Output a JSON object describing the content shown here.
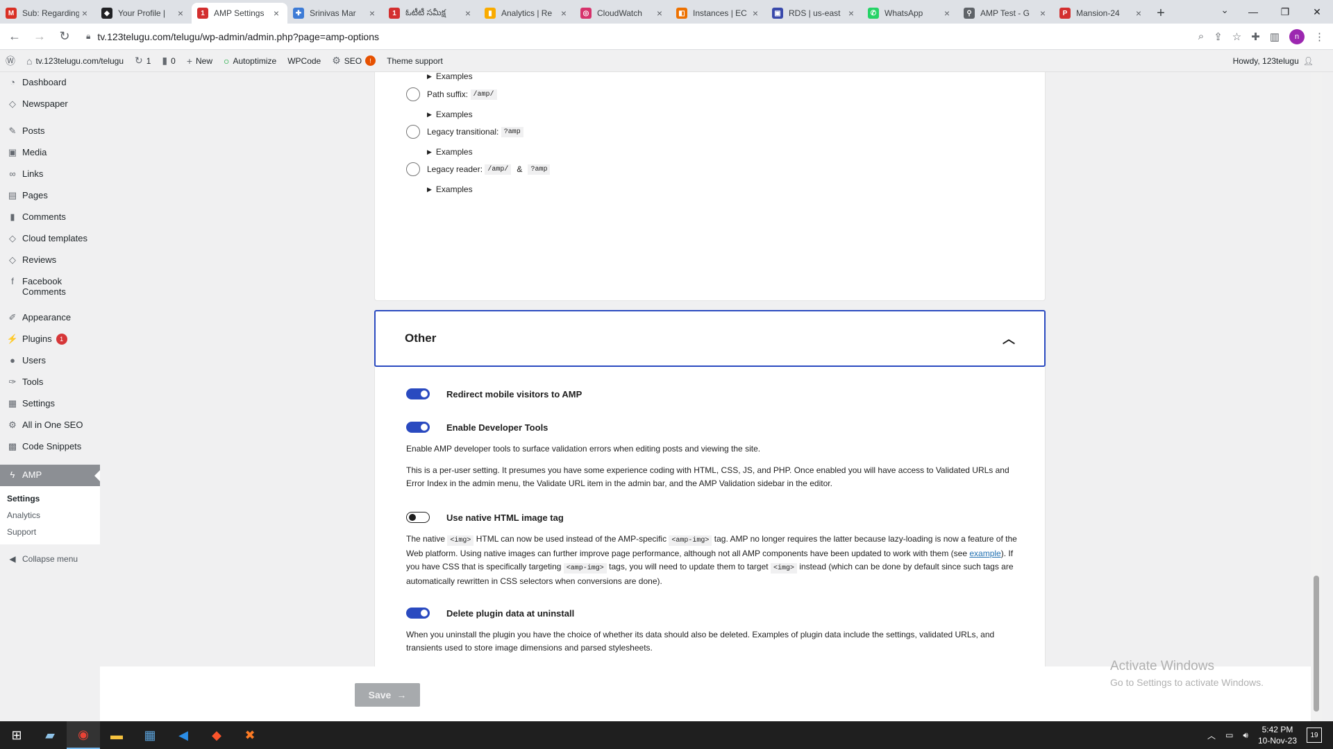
{
  "browser": {
    "tabs": [
      {
        "title": "Sub: Regarding",
        "favicon": "gmail-icon",
        "color": "#d93025",
        "glyph": "M"
      },
      {
        "title": "Your Profile |",
        "favicon": "eye-icon",
        "color": "#202124",
        "glyph": "◆"
      },
      {
        "title": "AMP Settings",
        "favicon": "123telugu-icon",
        "color": "#d32f2f",
        "glyph": "1",
        "active": true
      },
      {
        "title": "Srinivas Mar",
        "favicon": "puzzle-icon",
        "color": "#3d7bd6",
        "glyph": "✚"
      },
      {
        "title": "ఓటీటీ సమీక్ష",
        "favicon": "123telugu-icon",
        "color": "#d32f2f",
        "glyph": "1"
      },
      {
        "title": "Analytics | Re",
        "favicon": "analytics-icon",
        "color": "#f9ab00",
        "glyph": "▮"
      },
      {
        "title": "CloudWatch",
        "favicon": "cloudwatch-icon",
        "color": "#d6336c",
        "glyph": "◎"
      },
      {
        "title": "Instances | EC",
        "favicon": "ec2-icon",
        "color": "#ed7100",
        "glyph": "◧"
      },
      {
        "title": "RDS | us-east",
        "favicon": "rds-icon",
        "color": "#3949ab",
        "glyph": "▣"
      },
      {
        "title": "WhatsApp",
        "favicon": "whatsapp-icon",
        "color": "#25d366",
        "glyph": "✆"
      },
      {
        "title": "AMP Test - G",
        "favicon": "amp-test-icon",
        "color": "#5f6368",
        "glyph": "⚲"
      },
      {
        "title": "Mansion-24",
        "favicon": "mansion-icon",
        "color": "#d32f2f",
        "glyph": "P"
      }
    ],
    "url": "tv.123telugu.com/telugu/wp-admin/admin.php?page=amp-options"
  },
  "adminbar": {
    "site": "tv.123telugu.com/telugu",
    "updates": "1",
    "comments": "0",
    "new": "New",
    "autoptimize": "Autoptimize",
    "wpcode": "WPCode",
    "seo": "SEO",
    "seo_badge": "!",
    "theme_support": "Theme support",
    "howdy": "Howdy, 123telugu"
  },
  "sidebar": {
    "items": [
      {
        "label": "Dashboard",
        "icon": "dashboard-icon"
      },
      {
        "label": "Newspaper",
        "icon": "newspaper-icon"
      },
      {
        "label": "Posts",
        "icon": "pin-icon"
      },
      {
        "label": "Media",
        "icon": "media-icon"
      },
      {
        "label": "Links",
        "icon": "link-icon"
      },
      {
        "label": "Pages",
        "icon": "pages-icon"
      },
      {
        "label": "Comments",
        "icon": "comment-icon"
      },
      {
        "label": "Cloud templates",
        "icon": "cloud-icon"
      },
      {
        "label": "Reviews",
        "icon": "review-icon"
      },
      {
        "label": "Facebook Comments",
        "icon": "facebook-icon"
      },
      {
        "label": "Appearance",
        "icon": "brush-icon"
      },
      {
        "label": "Plugins",
        "icon": "plug-icon",
        "badge": "1"
      },
      {
        "label": "Users",
        "icon": "user-icon"
      },
      {
        "label": "Tools",
        "icon": "wrench-icon"
      },
      {
        "label": "Settings",
        "icon": "settings-icon"
      },
      {
        "label": "All in One SEO",
        "icon": "seo-icon"
      },
      {
        "label": "Code Snippets",
        "icon": "code-icon"
      },
      {
        "label": "AMP",
        "icon": "amp-icon"
      }
    ],
    "submenu": [
      "Settings",
      "Analytics",
      "Support"
    ],
    "collapse": "Collapse menu"
  },
  "url_structure": {
    "path_suffix_label": "Path suffix:",
    "path_suffix_code": "/amp/",
    "legacy_transitional_label": "Legacy transitional:",
    "legacy_transitional_code": "?amp",
    "legacy_reader_label": "Legacy reader:",
    "legacy_reader_code1": "/amp/",
    "legacy_reader_amp": "&",
    "legacy_reader_code2": "?amp",
    "examples": "Examples"
  },
  "other": {
    "title": "Other",
    "redirect_label": "Redirect mobile visitors to AMP",
    "devtools_label": "Enable Developer Tools",
    "devtools_desc1": "Enable AMP developer tools to surface validation errors when editing posts and viewing the site.",
    "devtools_desc2": "This is a per-user setting. It presumes you have some experience coding with HTML, CSS, JS, and PHP. Once enabled you will have access to Validated URLs and Error Index in the admin menu, the Validate URL item in the admin bar, and the AMP Validation sidebar in the editor.",
    "img_label": "Use native HTML image tag",
    "img_desc_p1": "The native ",
    "img_code1": "<img>",
    "img_desc_p2": " HTML can now be used instead of the AMP-specific ",
    "img_code2": "<amp-img>",
    "img_desc_p3": " tag. AMP no longer requires the latter because lazy-loading is now a feature of the Web platform. Using native images can further improve page performance, although not all AMP components have been updated to work with them (see ",
    "img_link": "example",
    "img_desc_p4": "). If you have CSS that is specifically targeting ",
    "img_code3": "<amp-img>",
    "img_desc_p5": " tags, you will need to update them to target ",
    "img_code4": "<img>",
    "img_desc_p6": " instead (which can be done by default since such tags are automatically rewritten in CSS selectors when conversions are done).",
    "delete_label": "Delete plugin data at uninstall",
    "delete_desc": "When you uninstall the plugin you have the choice of whether its data should also be deleted. Examples of plugin data include the settings, validated URLs, and transients used to store image dimensions and parsed stylesheets."
  },
  "save": {
    "label": "Save",
    "arrow": "→"
  },
  "watermark": {
    "line1": "Activate Windows",
    "line2": "Go to Settings to activate Windows."
  },
  "taskbar": {
    "time": "5:42 PM",
    "date": "10-Nov-23",
    "notifications": "19"
  }
}
